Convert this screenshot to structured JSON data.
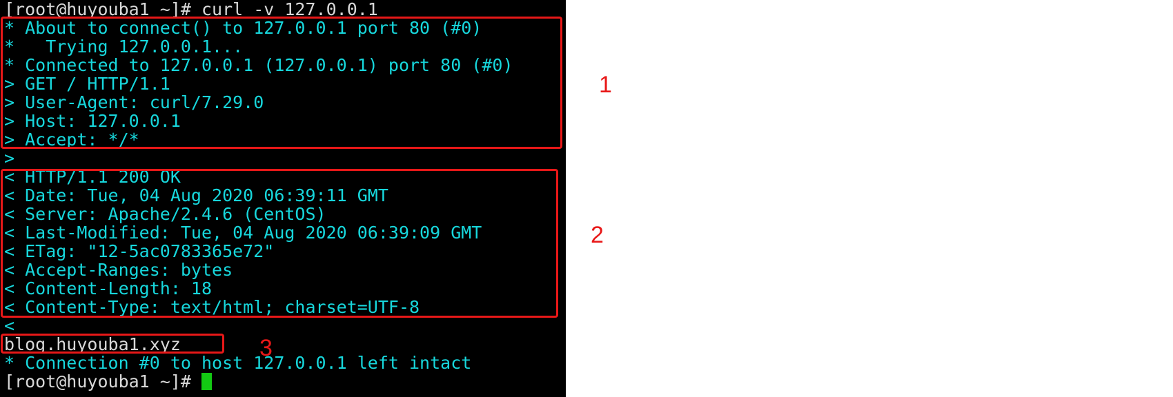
{
  "terminal": {
    "lines": [
      "[root@huyouba1 ~]# curl -v 127.0.0.1",
      "* About to connect() to 127.0.0.1 port 80 (#0)",
      "*   Trying 127.0.0.1...",
      "* Connected to 127.0.0.1 (127.0.0.1) port 80 (#0)",
      "> GET / HTTP/1.1",
      "> User-Agent: curl/7.29.0",
      "> Host: 127.0.0.1",
      "> Accept: */*",
      ">",
      "< HTTP/1.1 200 OK",
      "< Date: Tue, 04 Aug 2020 06:39:11 GMT",
      "< Server: Apache/2.4.6 (CentOS)",
      "< Last-Modified: Tue, 04 Aug 2020 06:39:09 GMT",
      "< ETag: \"12-5ac0783365e72\"",
      "< Accept-Ranges: bytes",
      "< Content-Length: 18",
      "< Content-Type: text/html; charset=UTF-8",
      "<",
      "blog.huyouba1.xyz",
      "* Connection #0 to host 127.0.0.1 left intact",
      "[root@huyouba1 ~]# "
    ],
    "cursor_color": "#13c913",
    "text_color": "#17d7dc",
    "background": "#000000"
  },
  "annotations": {
    "box_color": "#e81818",
    "labels": [
      "1",
      "2",
      "3"
    ]
  }
}
